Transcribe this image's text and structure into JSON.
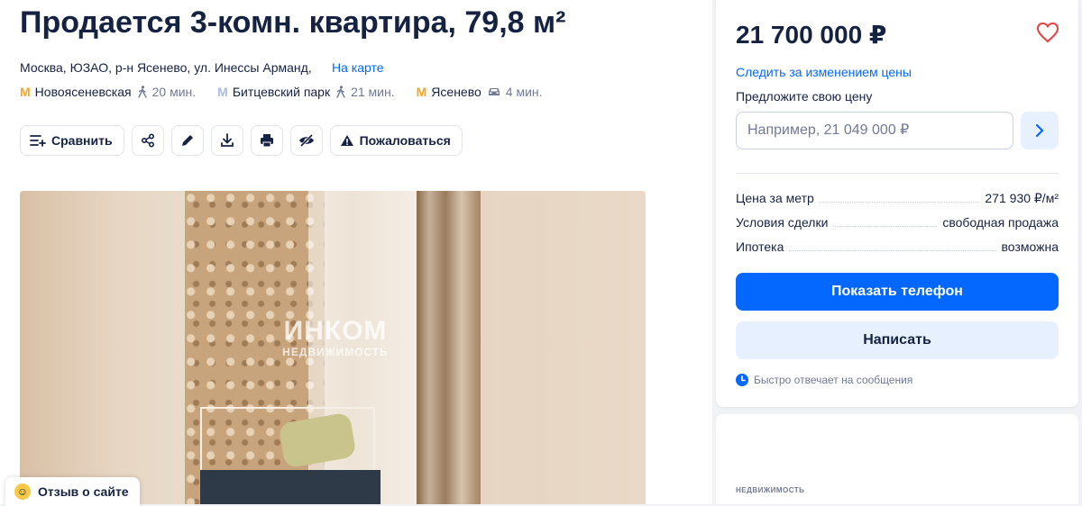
{
  "listing": {
    "title": "Продается 3-комн. квартира, 79,8 м²",
    "address": "Москва, ЮЗАО, р-н Ясенево, ул. Инессы Арманд,",
    "map_link": "На карте",
    "metro": [
      {
        "name": "Новоясеневская",
        "time": "20 мин.",
        "mode": "walk-icon",
        "color": "#f5a524"
      },
      {
        "name": "Битцевский парк",
        "time": "21 мин.",
        "mode": "walk-icon",
        "color": "#a8bde0"
      },
      {
        "name": "Ясенево",
        "time": "4 мин.",
        "mode": "car-icon",
        "color": "#f5a524"
      }
    ]
  },
  "toolbar": {
    "compare_label": "Сравнить",
    "complain_label": "Пожаловаться",
    "icons": [
      "compare-icon",
      "share-icon",
      "edit-icon",
      "download-icon",
      "print-icon",
      "hide-icon",
      "warning-icon"
    ]
  },
  "photo": {
    "watermark_main": "ИНКОМ",
    "watermark_sub": "НЕДВИЖИМОСТЬ"
  },
  "feedback": {
    "label": "Отзыв о сайте"
  },
  "sidebar": {
    "price": "21 700 000 ₽",
    "follow_price": "Следить за изменением цены",
    "offer_label": "Предложите свою цену",
    "offer_placeholder": "Например, 21 049 000 ₽",
    "details": [
      {
        "label": "Цена за метр",
        "value": "271 930 ₽/м²"
      },
      {
        "label": "Условия сделки",
        "value": "свободная продажа"
      },
      {
        "label": "Ипотека",
        "value": "возможна"
      }
    ],
    "show_phone": "Показать телефон",
    "write": "Написать",
    "fast_reply": "Быстро отвечает на сообщения",
    "second_card_logo": "НЕДВИЖИМОСТЬ"
  },
  "colors": {
    "accent": "#0468ff",
    "accent_light": "#e6f0ff",
    "text": "#152242",
    "muted": "#707a95",
    "heart": "#e8403f"
  }
}
